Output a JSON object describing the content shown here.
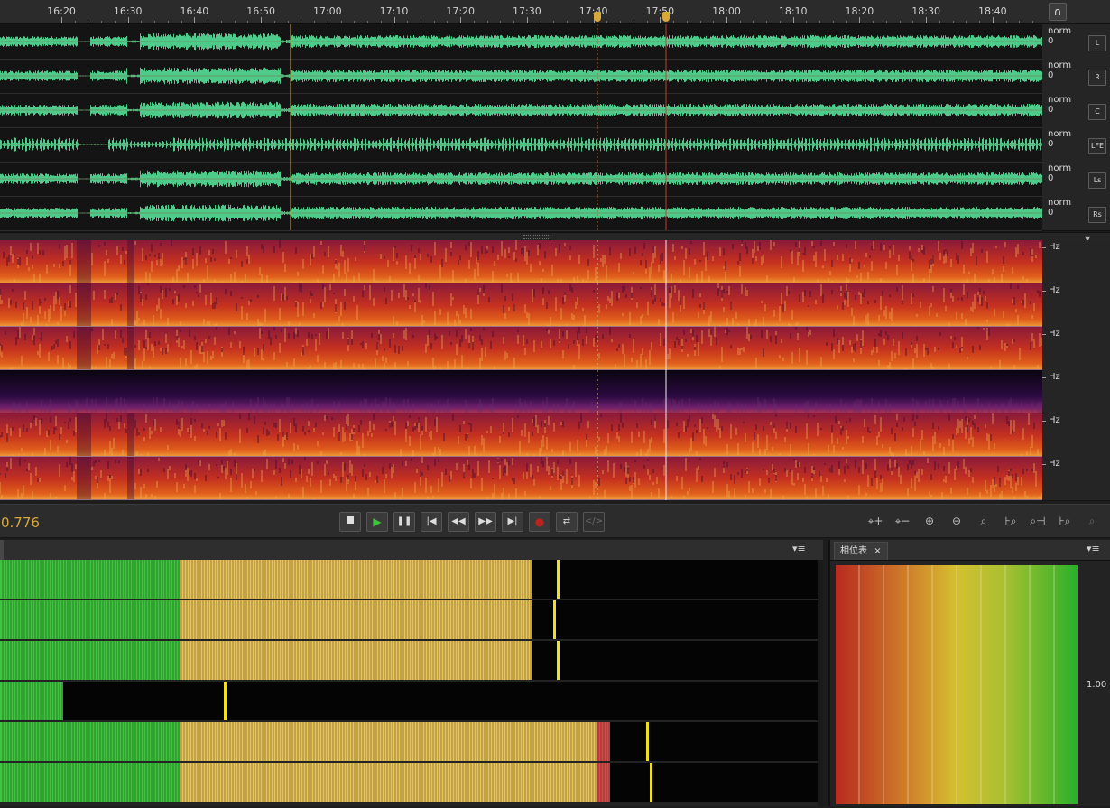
{
  "timeline": {
    "ticks": [
      "16:20",
      "16:30",
      "16:40",
      "16:50",
      "17:00",
      "17:10",
      "17:20",
      "17:30",
      "17:40",
      "17:50",
      "18:00",
      "18:10",
      "18:20",
      "18:30",
      "18:40"
    ],
    "headphones_icon": "headphones-icon"
  },
  "waveform": {
    "channels": [
      {
        "scale": "norm",
        "zero": "0",
        "button": "L"
      },
      {
        "scale": "norm",
        "zero": "0",
        "button": "R"
      },
      {
        "scale": "norm",
        "zero": "0",
        "button": "C"
      },
      {
        "scale": "norm",
        "zero": "0",
        "button": "LFE"
      },
      {
        "scale": "norm",
        "zero": "0",
        "button": "Ls"
      },
      {
        "scale": "norm",
        "zero": "0",
        "button": "Rs"
      }
    ],
    "color": "#4ecb8a"
  },
  "spectrogram": {
    "unit_labels": [
      "Hz",
      "Hz",
      "Hz",
      "Hz",
      "Hz",
      "Hz"
    ]
  },
  "transport": {
    "time": "0.776",
    "buttons": [
      "stop",
      "play",
      "pause",
      "go-to-start",
      "rewind",
      "fast-forward",
      "go-to-end",
      "record",
      "loop",
      "skip-selection"
    ],
    "zoom_buttons": [
      "zoom-in-amplitude",
      "zoom-out-amplitude",
      "zoom-in-point",
      "zoom-out-full",
      "zoom-selection",
      "zoom-in-left",
      "zoom-in-right",
      "zoom-out-left",
      "zoom-out-right"
    ]
  },
  "levels": {
    "menu": "▾≡",
    "colors": {
      "green": "#3ec43e",
      "yellow": "#e8c45a",
      "red": "#d84b4b",
      "peak": "#f0e020"
    }
  },
  "phase": {
    "tab_label": "相位表",
    "tab_close": "×",
    "menu": "▾≡",
    "scale_value": "1.00"
  }
}
